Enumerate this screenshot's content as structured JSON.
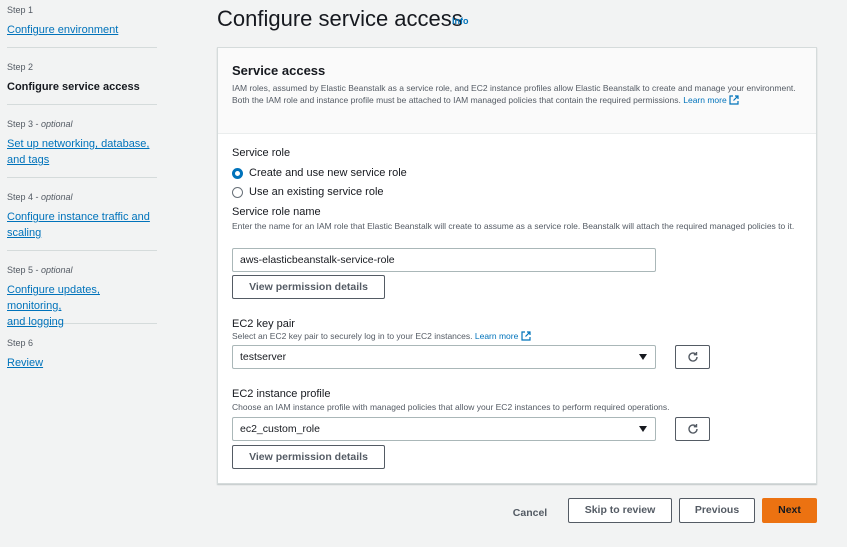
{
  "sidebar": {
    "steps": [
      {
        "step": "Step 1",
        "optional": "",
        "label": "Configure environment"
      },
      {
        "step": "Step 2",
        "optional": "",
        "label": "Configure service access"
      },
      {
        "step": "Step 3",
        "optional": "optional",
        "label_lines": [
          "Set up networking, database,",
          "and tags"
        ]
      },
      {
        "step": "Step 4",
        "optional": "optional",
        "label_lines": [
          "Configure instance traffic and",
          "scaling"
        ]
      },
      {
        "step": "Step 5",
        "optional": "optional",
        "label_lines": [
          "Configure updates, monitoring,",
          "and logging"
        ]
      },
      {
        "step": "Step 6",
        "optional": "",
        "label": "Review"
      }
    ]
  },
  "page": {
    "title": "Configure service access",
    "info": "Info"
  },
  "panel": {
    "title": "Service access",
    "description": "IAM roles, assumed by Elastic Beanstalk as a service role, and EC2 instance profiles allow Elastic Beanstalk to create and manage your environment. Both the IAM role and instance profile must be attached to IAM managed policies that contain the required permissions.",
    "learn_more": "Learn more",
    "service_role": {
      "label": "Service role",
      "options": [
        "Create and use new service role",
        "Use an existing service role"
      ],
      "selected_index": 0
    },
    "service_role_name": {
      "label": "Service role name",
      "description": "Enter the name for an IAM role that Elastic Beanstalk will create to assume as a service role. Beanstalk will attach the required managed policies to it.",
      "value": "aws-elasticbeanstalk-service-role",
      "button": "View permission details"
    },
    "key_pair": {
      "label": "EC2 key pair",
      "description": "Select an EC2 key pair to securely log in to your EC2 instances.",
      "learn_more": "Learn more",
      "value": "testserver"
    },
    "instance_profile": {
      "label": "EC2 instance profile",
      "description": "Choose an IAM instance profile with managed policies that allow your EC2 instances to perform required operations.",
      "value": "ec2_custom_role",
      "button": "View permission details"
    }
  },
  "footer": {
    "cancel": "Cancel",
    "skip": "Skip to review",
    "previous": "Previous",
    "next": "Next"
  },
  "colors": {
    "primary": "#ec7211",
    "link": "#0073bb"
  }
}
